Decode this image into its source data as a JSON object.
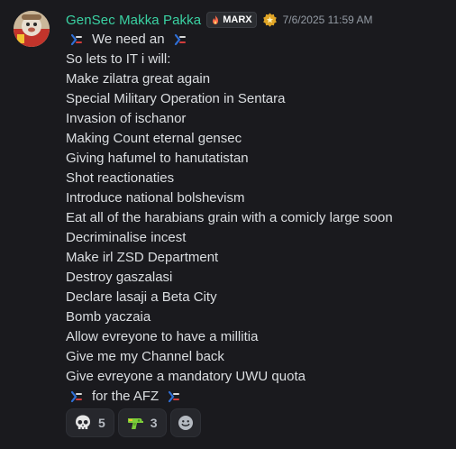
{
  "message": {
    "author": "GenSec Makka Pakka",
    "server_tag": "MARX",
    "timestamp": "7/6/2025 11:59 AM",
    "colors": {
      "author": "#3ad1a2",
      "text": "#dbdee1",
      "timestamp": "#949ba4",
      "background": "#1a1a1e"
    },
    "first_line": "We need an",
    "last_line": "for the AFZ",
    "lines": [
      "So lets to IT i will:",
      "Make zilatra great again",
      "Special Military Operation in Sentara",
      "Invasion of ischanor",
      "Making Count eternal gensec",
      "Giving hafumel to hanutatistan",
      "Shot reactionaties",
      "Introduce national bolshevism",
      "Eat all of the harabians grain with a comicly large soon",
      "Decriminalise incest",
      "Make irl ZSD Department",
      "Destroy gaszalasi",
      "Declare lasaji a Beta City",
      "Bomb yaczaia",
      "Allow evreyone to have a millitia",
      "Give me my Channel back",
      "Give evreyone a mandatory UWU quota"
    ],
    "inline_emoji": "flag-emoji"
  },
  "reactions": [
    {
      "icon": "skull-emoji",
      "count": "5"
    },
    {
      "icon": "water-gun-emoji",
      "count": "3"
    }
  ]
}
